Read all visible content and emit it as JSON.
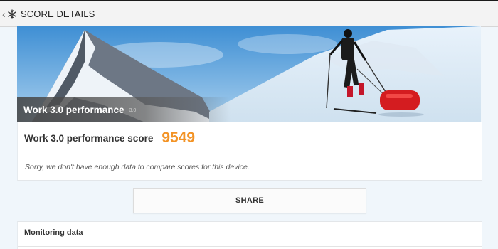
{
  "appbar": {
    "back_icon": "chevron-left-icon",
    "logo_icon": "snowflake-logo-icon",
    "title": "SCORE DETAILS"
  },
  "hero": {
    "image": "mountain-skier-illustration",
    "title": "Work 3.0 performance",
    "version": "3.0"
  },
  "score": {
    "label": "Work 3.0 performance score",
    "value": "9549",
    "value_color": "#f39325"
  },
  "note": {
    "text": "Sorry, we don't have enough data to compare scores for this device."
  },
  "share": {
    "label": "SHARE"
  },
  "monitoring": {
    "title": "Monitoring data"
  }
}
